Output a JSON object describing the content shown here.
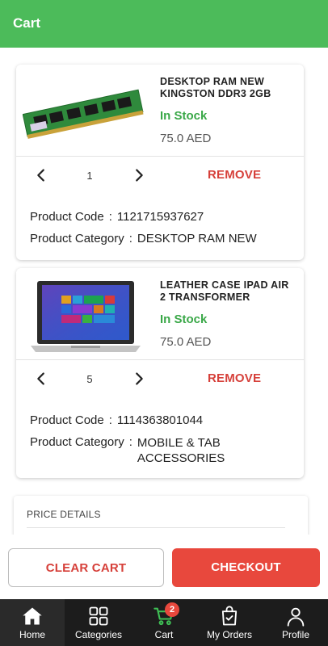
{
  "appbar": {
    "title": "Cart"
  },
  "items": [
    {
      "name": "DESKTOP RAM NEW KINGSTON DDR3 2GB",
      "stock": "In Stock",
      "price": "75.0 AED",
      "quantity": "1",
      "remove_label": "REMOVE",
      "code_label": "Product Code",
      "code": "1121715937627",
      "category_label": "Product Category",
      "category": "DESKTOP RAM NEW",
      "image_icon": "ram-module-image"
    },
    {
      "name": "LEATHER CASE IPAD AIR 2 TRANSFORMER",
      "stock": "In Stock",
      "price": "75.0 AED",
      "quantity": "5",
      "remove_label": "REMOVE",
      "code_label": "Product Code",
      "code": "1114363801044",
      "category_label": "Product Category",
      "category": "MOBILE & TAB ACCESSORIES",
      "image_icon": "laptop-image"
    }
  ],
  "separator": ":",
  "price_details": {
    "title": "PRICE DETAILS"
  },
  "actions": {
    "clear_label": "CLEAR CART",
    "checkout_label": "CHECKOUT"
  },
  "nav": {
    "items": [
      {
        "label": "Home",
        "icon": "home-icon"
      },
      {
        "label": "Categories",
        "icon": "grid-icon"
      },
      {
        "label": "Cart",
        "icon": "cart-icon",
        "badge": "2"
      },
      {
        "label": "My Orders",
        "icon": "bag-icon"
      },
      {
        "label": "Profile",
        "icon": "user-icon"
      }
    ]
  },
  "colors": {
    "primary_green": "#4cbb5a",
    "stock_green": "#3aa848",
    "accent_red": "#e8483d",
    "nav_bg": "#1c1c1c"
  }
}
